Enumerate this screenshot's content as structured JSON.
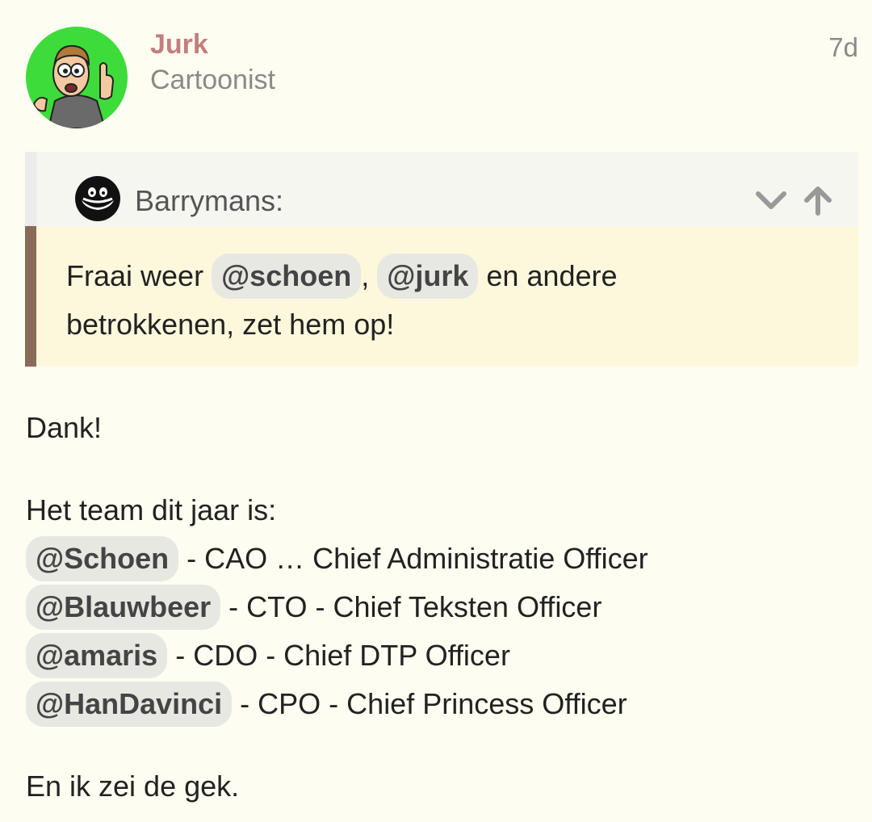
{
  "post": {
    "author": "Jurk",
    "author_title": "Cartoonist",
    "date": "7d"
  },
  "quote": {
    "author": "Barrymans:",
    "text_pre": "Fraai weer ",
    "mention1": "@schoen",
    "sep": ", ",
    "mention2": "@jurk",
    "text_post1": " en andere",
    "text_post2": "betrokkenen, zet hem op!"
  },
  "body": {
    "thanks": "Dank!",
    "team_intro": "Het team dit jaar is:",
    "roles": [
      {
        "mention": "@Schoen",
        "text": " - CAO … Chief Administratie Officer"
      },
      {
        "mention": "@Blauwbeer",
        "text": " - CTO - Chief Teksten Officer"
      },
      {
        "mention": "@amaris",
        "text": " - CDO - Chief DTP Officer"
      },
      {
        "mention": "@HanDavinci",
        "text": " - CPO - Chief Princess Officer"
      }
    ],
    "closing": "En ik zei de gek."
  },
  "colors": {
    "background": "#fdfdf1",
    "author": "#c47d7d",
    "avatar_bg": "#3ddc3a",
    "quote_bar": "#8a6a58",
    "quote_bg": "#fdf7dc",
    "mention_bg": "#e8e8e3"
  },
  "icons": {
    "expand": "chevron-down-icon",
    "go_to_quoted": "arrow-up-icon"
  }
}
